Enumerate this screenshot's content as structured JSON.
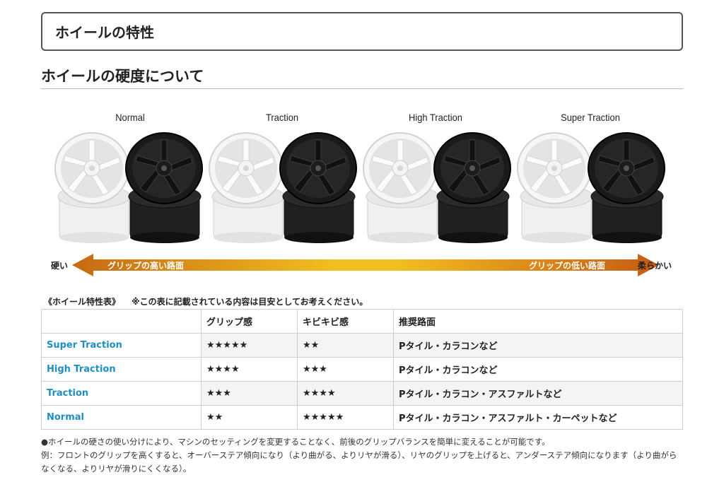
{
  "page": {
    "title": "ホイールの特性",
    "heading": "ホイールの硬度について"
  },
  "wheels": [
    {
      "label": "Normal"
    },
    {
      "label": "Traction"
    },
    {
      "label": "High Traction"
    },
    {
      "label": "Super Traction"
    }
  ],
  "arrow": {
    "left_end": "硬い",
    "right_end": "柔らかい",
    "left_text": "グリップの高い路面",
    "right_text": "グリップの低い路面"
  },
  "table": {
    "caption": "《ホイール特性表》",
    "note": "※この表に記載されている内容は目安としてお考えください。",
    "headers": [
      "",
      "グリップ感",
      "キビキビ感",
      "推奨路面"
    ],
    "rows": [
      {
        "name": "Super Traction",
        "grip": "★★★★★",
        "agility": "★★",
        "surface": "Pタイル・カラコンなど"
      },
      {
        "name": "High Traction",
        "grip": "★★★★",
        "agility": "★★★",
        "surface": "Pタイル・カラコンなど"
      },
      {
        "name": "Traction",
        "grip": "★★★",
        "agility": "★★★★",
        "surface": "Pタイル・カラコン・アスファルトなど"
      },
      {
        "name": "Normal",
        "grip": "★★",
        "agility": "★★★★★",
        "surface": "Pタイル・カラコン・アスファルト・カーペットなど"
      }
    ]
  },
  "notes": {
    "line1": "●ホイールの硬さの使い分けにより、マシンのセッティングを変更することなく、前後のグリップバランスを簡単に変えることが可能です。",
    "line2": "例：フロントのグリップを高くすると、オーバーステア傾向になり（より曲がる、よりリヤが滑る）、リヤのグリップを上げると、アンダーステア傾向になります（より曲がらなくなる、よりリヤが滑りにくくなる）。"
  },
  "colors": {
    "white_wheel": "#f3f3f3",
    "black_wheel": "#1b1b1b",
    "arrow_start": "#c56a12",
    "arrow_mid": "#f3bf1f",
    "arrow_end": "#c65a13",
    "link_blue": "#1e8fc6"
  }
}
